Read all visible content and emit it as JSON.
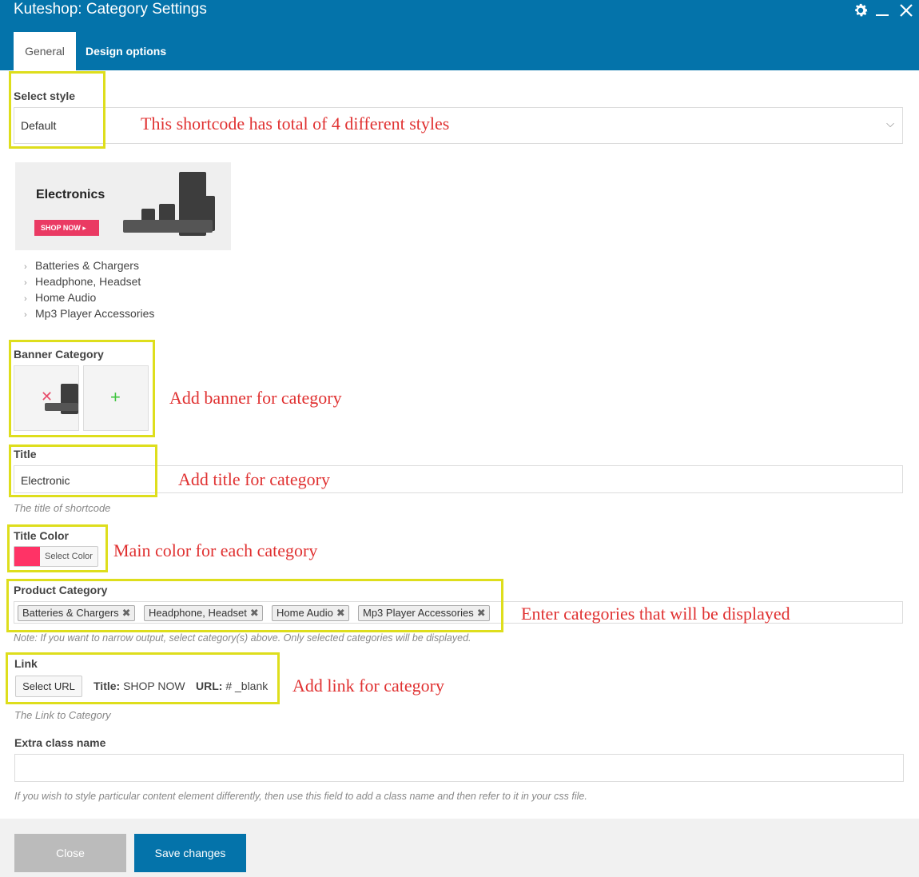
{
  "window": {
    "title": "Kuteshop: Category Settings",
    "icons": [
      "gear-icon",
      "minimize-icon",
      "close-icon"
    ]
  },
  "tabs": [
    {
      "label": "General",
      "active": true
    },
    {
      "label": "Design options",
      "active": false
    }
  ],
  "select_style": {
    "label": "Select style",
    "value": "Default",
    "annotation": "This shortcode has total of 4 different styles"
  },
  "preview": {
    "banner_title": "Electronics",
    "banner_button": "SHOP NOW",
    "items": [
      "Batteries & Chargers",
      "Headphone, Headset",
      "Home Audio",
      "Mp3 Player Accessories"
    ]
  },
  "banner_category": {
    "label": "Banner Category",
    "annotation": "Add banner for category"
  },
  "title_field": {
    "label": "Title",
    "value": "Electronic",
    "hint": "The title of shortcode",
    "annotation": "Add title for category"
  },
  "title_color": {
    "label": "Title Color",
    "button": "Select Color",
    "color": "#ff3366",
    "annotation": "Main color for each category"
  },
  "product_category": {
    "label": "Product Category",
    "tags": [
      "Batteries & Chargers",
      "Headphone, Headset",
      "Home Audio",
      "Mp3 Player Accessories"
    ],
    "hint": "Note: If you want to narrow output, select category(s) above. Only selected categories will be displayed.",
    "annotation": "Enter categories that will be displayed"
  },
  "link": {
    "label": "Link",
    "button": "Select URL",
    "title_label": "Title:",
    "title_value": "SHOP NOW",
    "url_label": "URL:",
    "url_value": "# _blank",
    "hint": "The Link to Category",
    "annotation": "Add link for category"
  },
  "extra_class": {
    "label": "Extra class name",
    "value": "",
    "hint": "If you wish to style particular content element differently, then use this field to add a class name and then refer to it in your css file."
  },
  "footer": {
    "close_label": "Close",
    "save_label": "Save changes"
  },
  "colors": {
    "header": "#0473aa",
    "annotation": "#e03131",
    "highlight_box": "#dede1c"
  }
}
